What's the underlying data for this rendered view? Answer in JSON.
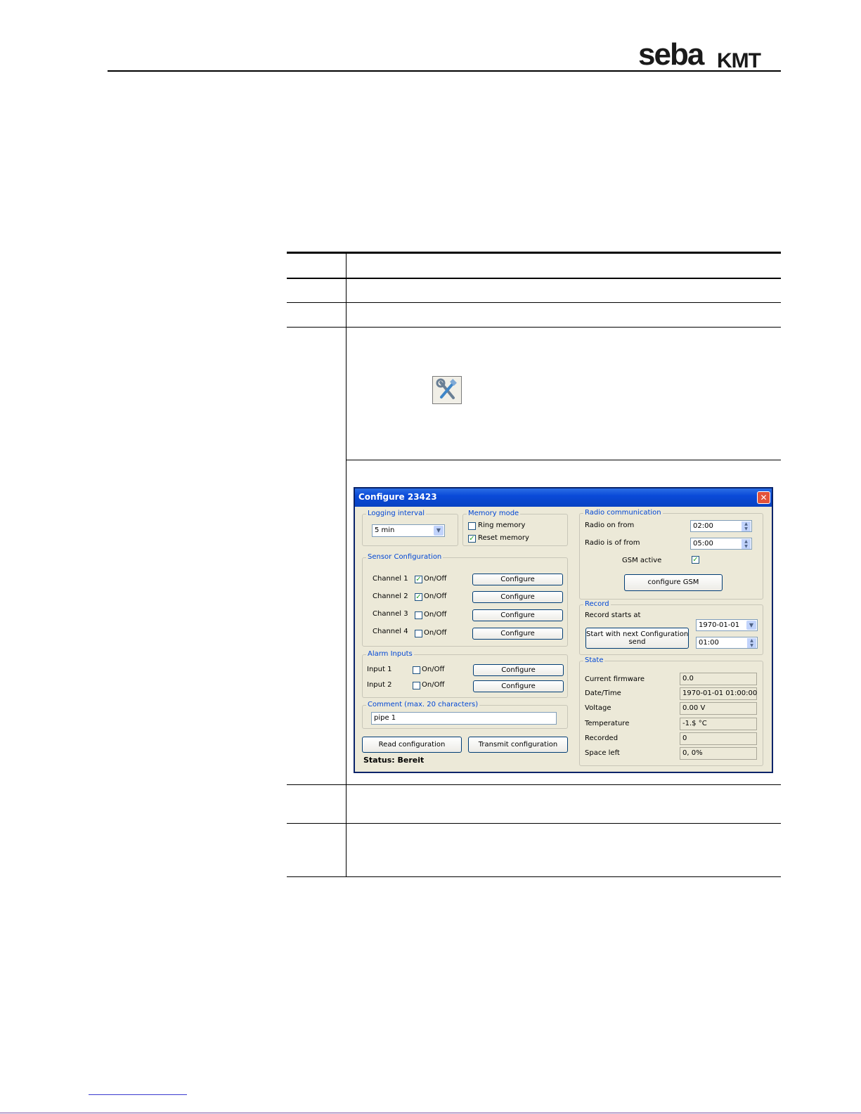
{
  "header": {
    "logo_main": "seba",
    "logo_sub": "KMT"
  },
  "dialog": {
    "title": "Configure 23423",
    "close_icon": "close-icon",
    "logging": {
      "title": "Logging interval",
      "value": "5 min"
    },
    "memory": {
      "title": "Memory mode",
      "ring_label": "Ring memory",
      "ring_checked": false,
      "reset_label": "Reset memory",
      "reset_checked": true
    },
    "sensor": {
      "title": "Sensor Configuration",
      "channels": [
        {
          "label": "Channel 1",
          "toggle": "On/Off",
          "checked": true,
          "button": "Configure"
        },
        {
          "label": "Channel 2",
          "toggle": "On/Off",
          "checked": true,
          "button": "Configure"
        },
        {
          "label": "Channel 3",
          "toggle": "On/Off",
          "checked": false,
          "button": "Configure"
        },
        {
          "label": "Channel 4",
          "toggle": "On/Off",
          "checked": false,
          "button": "Configure"
        }
      ]
    },
    "alarm": {
      "title": "Alarm Inputs",
      "inputs": [
        {
          "label": "Input 1",
          "toggle": "On/Off",
          "checked": false,
          "button": "Configure"
        },
        {
          "label": "Input 2",
          "toggle": "On/Off",
          "checked": false,
          "button": "Configure"
        }
      ]
    },
    "comment": {
      "title": "Comment (max. 20 characters)",
      "value": "pipe 1"
    },
    "read_button": "Read configuration",
    "transmit_button": "Transmit configuration",
    "status": "Status: Bereit",
    "radio": {
      "title": "Radio communication",
      "on_label": "Radio on from",
      "on_value": "02:00",
      "off_label": "Radio is of from",
      "off_value": "05:00",
      "gsm_label": "GSM active",
      "gsm_checked": true,
      "gsm_button": "configure GSM"
    },
    "record": {
      "title": "Record",
      "starts_label": "Record starts at",
      "start_button_line1": "Start with next Configuration",
      "start_button_line2": "send",
      "date_value": "1970-01-01",
      "time_value": "01:00"
    },
    "state": {
      "title": "State",
      "rows": [
        {
          "label": "Current firmware",
          "value": "0.0"
        },
        {
          "label": "Date/Time",
          "value": "1970-01-01 01:00:00"
        },
        {
          "label": "Voltage",
          "value": "0.00 V"
        },
        {
          "label": "Temperature",
          "value": "-1.$ °C"
        },
        {
          "label": "Recorded",
          "value": "0"
        },
        {
          "label": "Space left",
          "value": "0, 0%"
        }
      ]
    }
  }
}
